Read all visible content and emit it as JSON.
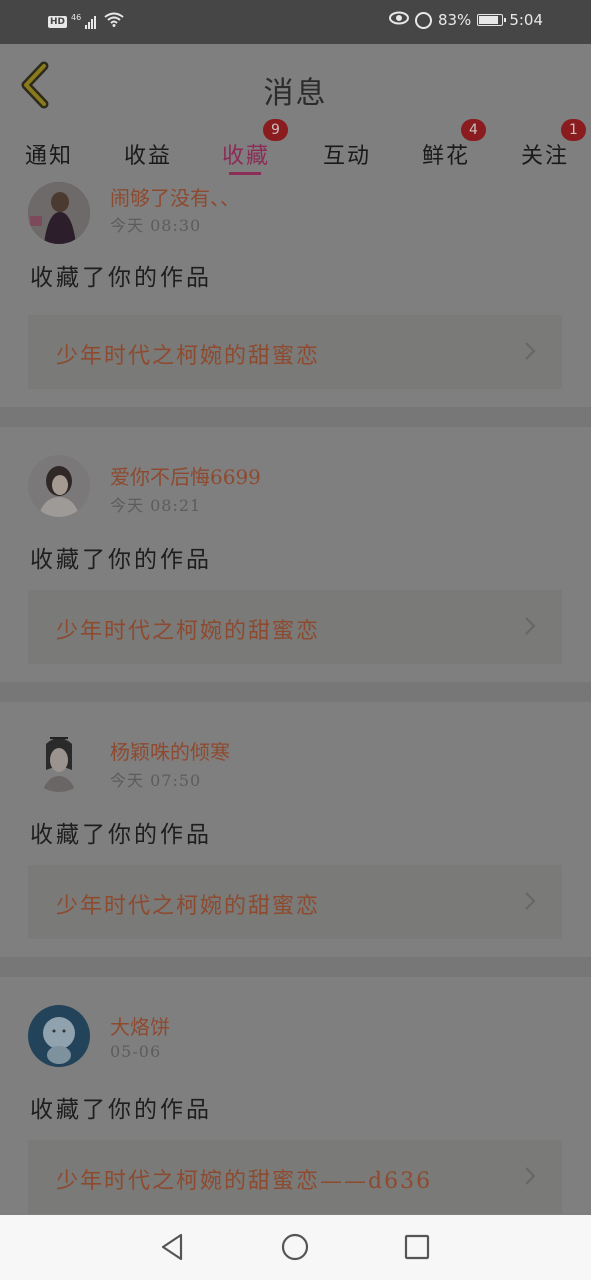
{
  "status_bar": {
    "hd": "HD",
    "network": "46",
    "battery": "83%",
    "battery_level": 0.83,
    "time": "5:04"
  },
  "header": {
    "title": "消息",
    "back_icon": "chevron-left-icon"
  },
  "tabs": [
    {
      "label": "通知",
      "badge": ""
    },
    {
      "label": "收益",
      "badge": ""
    },
    {
      "label": "收藏",
      "badge": "9",
      "active": true
    },
    {
      "label": "互动",
      "badge": ""
    },
    {
      "label": "鲜花",
      "badge": "4"
    },
    {
      "label": "关注",
      "badge": "1"
    }
  ],
  "items": [
    {
      "username": "闹够了没有、、",
      "time": "今天  08:30",
      "action": "收藏了你的作品",
      "work": "少年时代之柯婉的甜蜜恋"
    },
    {
      "username": "爱你不后悔6699",
      "time": "今天  08:21",
      "action": "收藏了你的作品",
      "work": "少年时代之柯婉的甜蜜恋"
    },
    {
      "username": "杨颖咮的倾寒",
      "time": "今天  07:50",
      "action": "收藏了你的作品",
      "work": "少年时代之柯婉的甜蜜恋"
    },
    {
      "username": "大烙饼",
      "time": "05-06",
      "action": "收藏了你的作品",
      "work": "少年时代之柯婉的甜蜜恋——d636"
    }
  ],
  "colors": {
    "overlay": "#7f7f7f",
    "accent": "#8b2d57",
    "badge": "#8a1c1f",
    "link": "#8e4a2f"
  }
}
